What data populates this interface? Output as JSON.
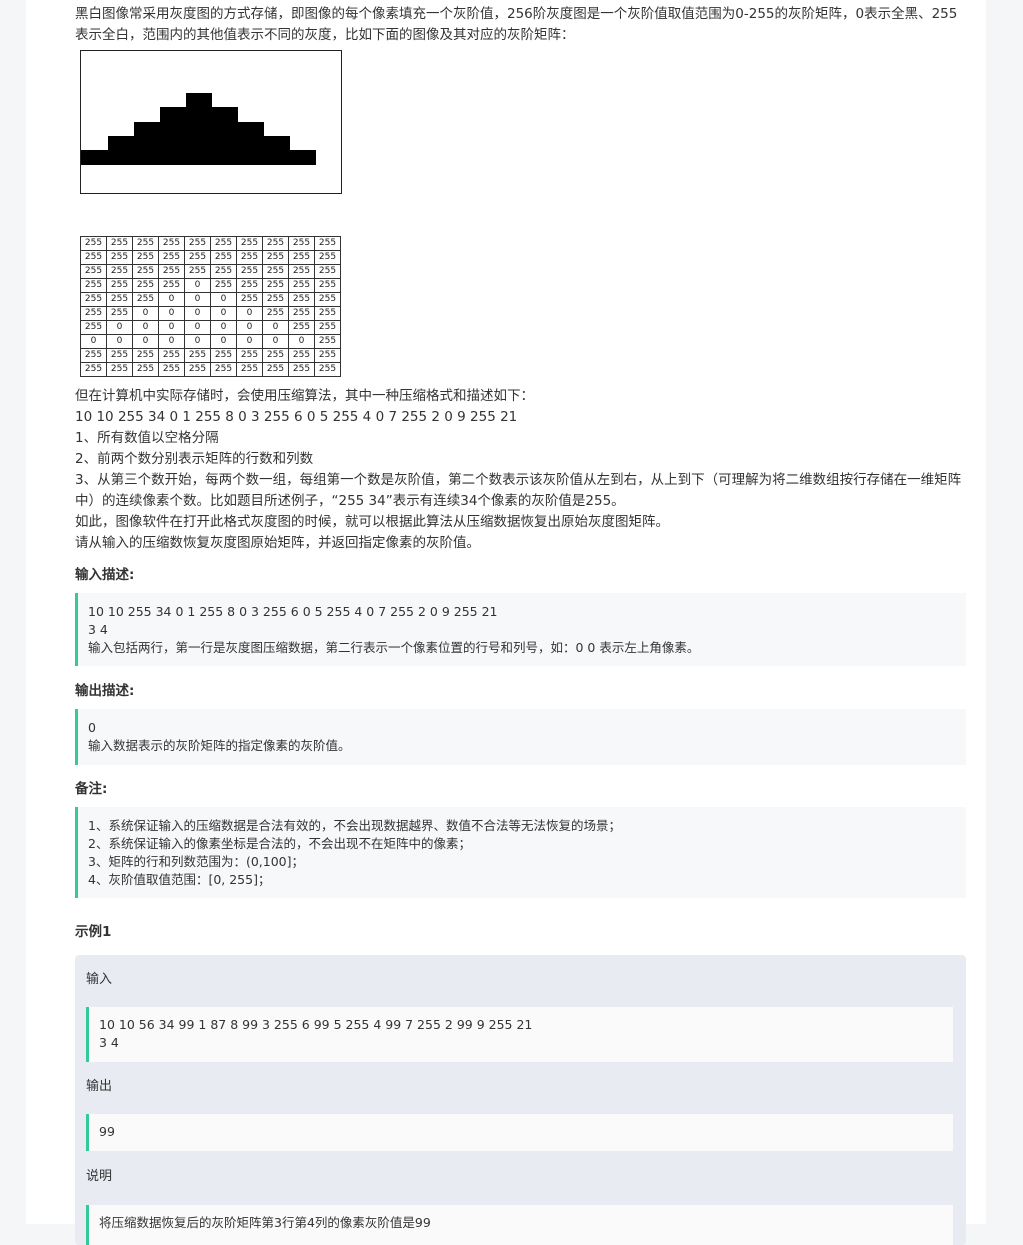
{
  "intro": "黑白图像常采用灰度图的方式存储，即图像的每个像素填充一个灰阶值，256阶灰度图是一个灰阶值取值范围为0-255的灰阶矩阵，0表示全黑、255表示全白，范围内的其他值表示不同的灰度，比如下面的图像及其对应的灰阶矩阵：",
  "matrix": [
    [
      "255",
      "255",
      "255",
      "255",
      "255",
      "255",
      "255",
      "255",
      "255",
      "255"
    ],
    [
      "255",
      "255",
      "255",
      "255",
      "255",
      "255",
      "255",
      "255",
      "255",
      "255"
    ],
    [
      "255",
      "255",
      "255",
      "255",
      "255",
      "255",
      "255",
      "255",
      "255",
      "255"
    ],
    [
      "255",
      "255",
      "255",
      "255",
      "0",
      "255",
      "255",
      "255",
      "255",
      "255"
    ],
    [
      "255",
      "255",
      "255",
      "0",
      "0",
      "0",
      "255",
      "255",
      "255",
      "255"
    ],
    [
      "255",
      "255",
      "0",
      "0",
      "0",
      "0",
      "0",
      "255",
      "255",
      "255"
    ],
    [
      "255",
      "0",
      "0",
      "0",
      "0",
      "0",
      "0",
      "0",
      "255",
      "255"
    ],
    [
      "0",
      "0",
      "0",
      "0",
      "0",
      "0",
      "0",
      "0",
      "0",
      "255"
    ],
    [
      "255",
      "255",
      "255",
      "255",
      "255",
      "255",
      "255",
      "255",
      "255",
      "255"
    ],
    [
      "255",
      "255",
      "255",
      "255",
      "255",
      "255",
      "255",
      "255",
      "255",
      "255"
    ]
  ],
  "description": [
    "但在计算机中实际存储时，会使用压缩算法，其中一种压缩格式和描述如下：",
    "10 10 255 34 0 1 255 8 0 3 255 6 0 5 255 4 0 7 255 2 0 9 255 21",
    "1、所有数值以空格分隔",
    "2、前两个数分别表示矩阵的行数和列数",
    "3、从第三个数开始，每两个数一组，每组第一个数是灰阶值，第二个数表示该灰阶值从左到右，从上到下（可理解为将二维数组按行存储在一维矩阵中）的连续像素个数。比如题目所述例子，“255 34”表示有连续34个像素的灰阶值是255。",
    "如此，图像软件在打开此格式灰度图的时候，就可以根据此算法从压缩数据恢复出原始灰度图矩阵。",
    "请从输入的压缩数恢复灰度图原始矩阵，并返回指定像素的灰阶值。"
  ],
  "input_desc": {
    "title": "输入描述:",
    "lines": [
      "10 10 255 34 0 1 255 8 0 3 255 6 0 5 255 4 0 7 255 2 0 9 255 21",
      "3 4",
      "输入包括两行，第一行是灰度图压缩数据，第二行表示一个像素位置的行号和列号，如：0 0 表示左上角像素。"
    ]
  },
  "output_desc": {
    "title": "输出描述:",
    "lines": [
      "0",
      "输入数据表示的灰阶矩阵的指定像素的灰阶值。"
    ]
  },
  "notes": {
    "title": "备注:",
    "lines": [
      "1、系统保证输入的压缩数据是合法有效的，不会出现数据越界、数值不合法等无法恢复的场景；",
      "2、系统保证输入的像素坐标是合法的，不会出现不在矩阵中的像素；",
      "3、矩阵的行和列数范围为：(0,100]；",
      "4、灰阶值取值范围：[0, 255]；"
    ]
  },
  "example": {
    "title": "示例1",
    "input_label": "输入",
    "input_lines": [
      "10 10 56 34 99 1 87 8 99 3 255 6 99 5 255 4 99 7 255 2 99 9 255 21",
      "3 4"
    ],
    "output_label": "输出",
    "output_lines": [
      "99"
    ],
    "explain_label": "说明",
    "explain_lines": [
      "将压缩数据恢复后的灰阶矩阵第3行第4列的像素灰阶值是99"
    ]
  }
}
